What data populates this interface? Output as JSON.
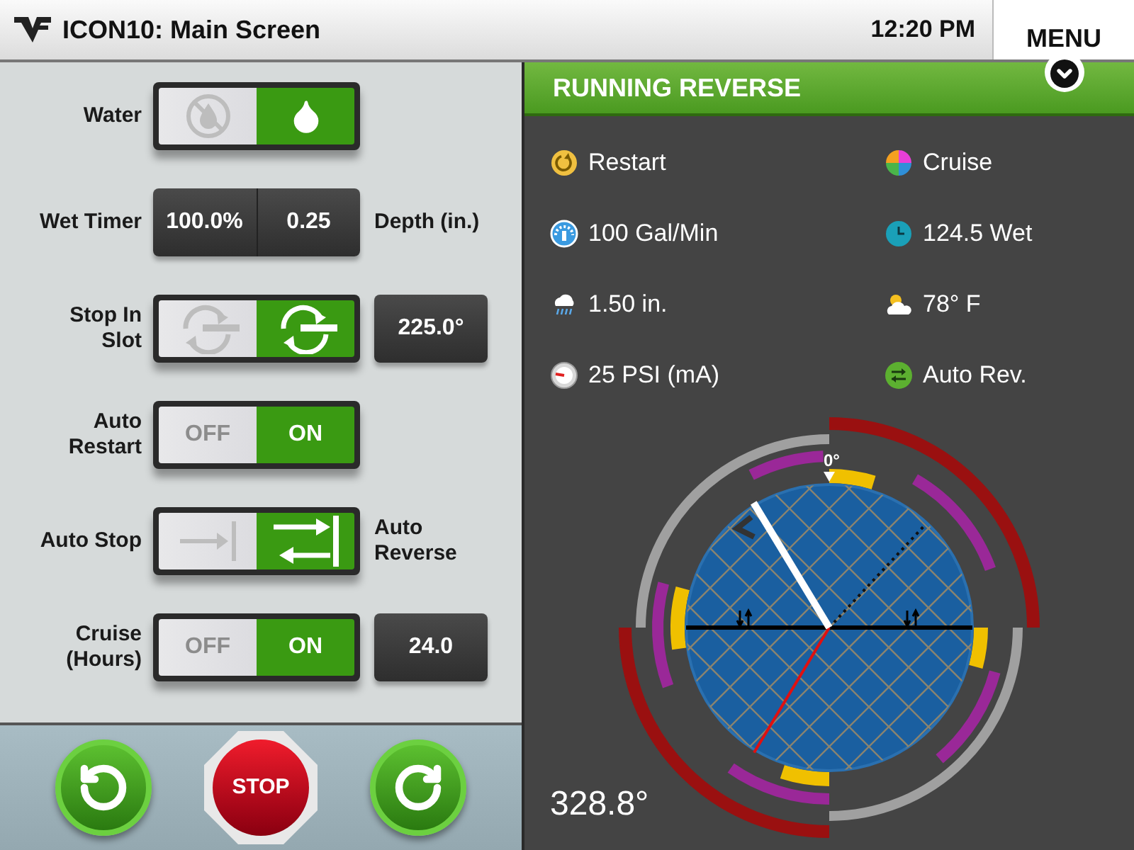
{
  "header": {
    "title": "ICON10: Main Screen",
    "time": "12:20 PM",
    "menu": "MENU"
  },
  "controls": [
    {
      "kind": "water-toggle",
      "label": "Water",
      "on": true
    },
    {
      "kind": "values",
      "label": "Wet Timer",
      "values": [
        "100.0%",
        "0.25"
      ],
      "side_label": "Depth (in.)"
    },
    {
      "kind": "slot-toggle",
      "label": "Stop In Slot",
      "on": true,
      "value": "225.0°"
    },
    {
      "kind": "text-toggle",
      "label": "Auto Restart",
      "on": true,
      "off_text": "OFF",
      "on_text": "ON"
    },
    {
      "kind": "reverse-toggle",
      "label": "Auto Stop",
      "on": true,
      "side_label": "Auto Reverse"
    },
    {
      "kind": "text-toggle",
      "label": "Cruise (Hours)",
      "on": true,
      "off_text": "OFF",
      "on_text": "ON",
      "value": "24.0"
    }
  ],
  "actions": [
    {
      "kind": "reverse"
    },
    {
      "kind": "stop",
      "label": "STOP"
    },
    {
      "kind": "forward"
    }
  ],
  "status_banner": "RUNNING REVERSE",
  "status": [
    {
      "kind": "restart",
      "text": "Restart"
    },
    {
      "kind": "cruise",
      "text": "Cruise"
    },
    {
      "kind": "flow",
      "text": "100 Gal/Min"
    },
    {
      "kind": "clock",
      "text": "124.5 Wet"
    },
    {
      "kind": "rain",
      "text": "1.50 in."
    },
    {
      "kind": "weather",
      "text": "78° F"
    },
    {
      "kind": "pressure",
      "text": "25 PSI (mA)"
    },
    {
      "kind": "autorev",
      "text": "Auto Rev."
    }
  ],
  "dial": {
    "zero_label": "0°",
    "heading": "328.8°"
  }
}
